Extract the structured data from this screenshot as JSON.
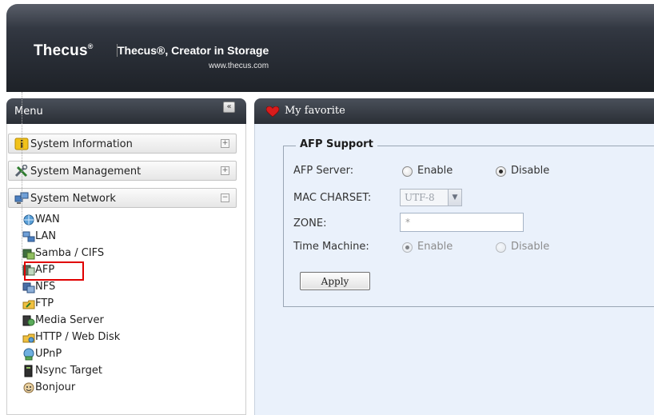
{
  "header": {
    "logo_text": "Thecus",
    "logo_mark": "®",
    "tagline": "Thecus®, Creator in Storage",
    "url": "www.thecus.com"
  },
  "menu": {
    "title": "Menu",
    "collapse_label": "«",
    "categories": [
      {
        "label": "System Information",
        "icon": "info-icon",
        "toggle": "+"
      },
      {
        "label": "System Management",
        "icon": "tools-icon",
        "toggle": "+"
      },
      {
        "label": "System Network",
        "icon": "network-icon",
        "toggle": "−"
      }
    ],
    "items": [
      {
        "label": "WAN",
        "icon": "wan-icon"
      },
      {
        "label": "LAN",
        "icon": "lan-icon"
      },
      {
        "label": "Samba / CIFS",
        "icon": "samba-icon"
      },
      {
        "label": "AFP",
        "icon": "afp-icon",
        "selected": true
      },
      {
        "label": "NFS",
        "icon": "nfs-icon"
      },
      {
        "label": "FTP",
        "icon": "ftp-icon"
      },
      {
        "label": "Media Server",
        "icon": "media-server-icon"
      },
      {
        "label": "HTTP / Web Disk",
        "icon": "http-icon"
      },
      {
        "label": "UPnP",
        "icon": "upnp-icon"
      },
      {
        "label": "Nsync Target",
        "icon": "nsync-icon"
      },
      {
        "label": "Bonjour",
        "icon": "bonjour-icon"
      }
    ]
  },
  "favorite": {
    "title": "My favorite",
    "icon": "heart-icon"
  },
  "afp": {
    "legend": "AFP Support",
    "server": {
      "label": "AFP Server:",
      "enable": "Enable",
      "disable": "Disable",
      "value": "Disable"
    },
    "charset": {
      "label": "MAC CHARSET:",
      "value": "UTF-8"
    },
    "zone": {
      "label": "ZONE:",
      "value": "*"
    },
    "time_machine": {
      "label": "Time Machine:",
      "enable": "Enable",
      "disable": "Disable",
      "value": "Enable",
      "disabled": true
    },
    "apply_label": "Apply"
  },
  "colors": {
    "header_bg": "#2c313a",
    "content_bg": "#eaf1fb",
    "selection_border": "#e00000"
  }
}
